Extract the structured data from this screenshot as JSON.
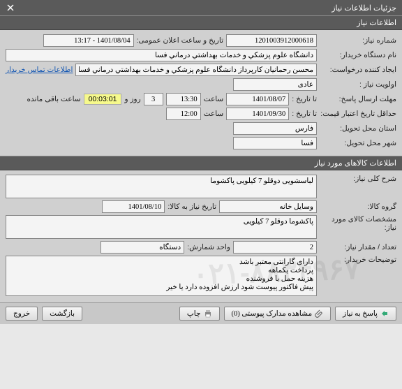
{
  "window": {
    "title": "جزئیات اطلاعات نیاز"
  },
  "section1": {
    "header": "اطلاعات نیاز",
    "need_no_label": "شماره نیاز:",
    "need_no": "1201003912000618",
    "announce_label": "تاریخ و ساعت اعلان عمومی:",
    "announce_value": "1401/08/04 - 13:17",
    "buyer_label": "نام دستگاه خریدار:",
    "buyer_value": "دانشگاه علوم پزشكي و خدمات بهداشتي درماني فسا",
    "creator_label": "ایجاد کننده درخواست:",
    "creator_value": "محسن رحمانیان کارپرداز دانشگاه علوم پزشكي و خدمات بهداشتي درماني فسا",
    "contact_link": "اطلاعات تماس خریدار",
    "priority_label": "اولویت نیاز :",
    "priority_value": "عادی",
    "deadline_label": "مهلت ارسال پاسخ:",
    "to_date_label": "تا تاریخ :",
    "deadline_date": "1401/08/07",
    "time_label": "ساعت",
    "deadline_time": "13:30",
    "days_value": "3",
    "days_label": "روز و",
    "timer": "00:03:01",
    "remain_label": "ساعت باقی مانده",
    "validity_label": "حداقل تاریخ اعتبار قیمت:",
    "validity_date": "1401/09/30",
    "validity_time": "12:00",
    "province_label": "استان محل تحویل:",
    "province_value": "فارس",
    "city_label": "شهر محل تحویل:",
    "city_value": "فسا"
  },
  "section2": {
    "header": "اطلاعات کالاهای مورد نیاز",
    "desc_label": "شرح کلی نیاز:",
    "desc_value": "لباسشویی دوقلو 7 کیلویی پاکشوما",
    "group_label": "گروه کالا:",
    "group_value": "وسایل خانه",
    "need_date_label": "تاریخ نیاز به کالا:",
    "need_date_value": "1401/08/10",
    "spec_label": "مشخصات کالای مورد نیاز:",
    "spec_value": "پاکشوما دوقلو 7 کیلویی",
    "qty_label": "تعداد / مقدار نیاز:",
    "qty_value": "2",
    "unit_label": "واحد شمارش:",
    "unit_value": "دستگاه",
    "notes_label": "توضیحات خریدار:",
    "notes_value": "دارای گارانتی معتبر باشد\nپرداخت یکماهه\nهزینه حمل با فروشنده\nپیش فاکتور پیوست شود ارزش افزوده دارد یا خیر"
  },
  "watermark": "۰۲۱-۸۸۳۴۹۶۷",
  "buttons": {
    "reply": "پاسخ به نیاز",
    "attach": "مشاهده مدارک پیوستی (0)",
    "print": "چاپ",
    "back": "بازگشت",
    "exit": "خروج"
  }
}
